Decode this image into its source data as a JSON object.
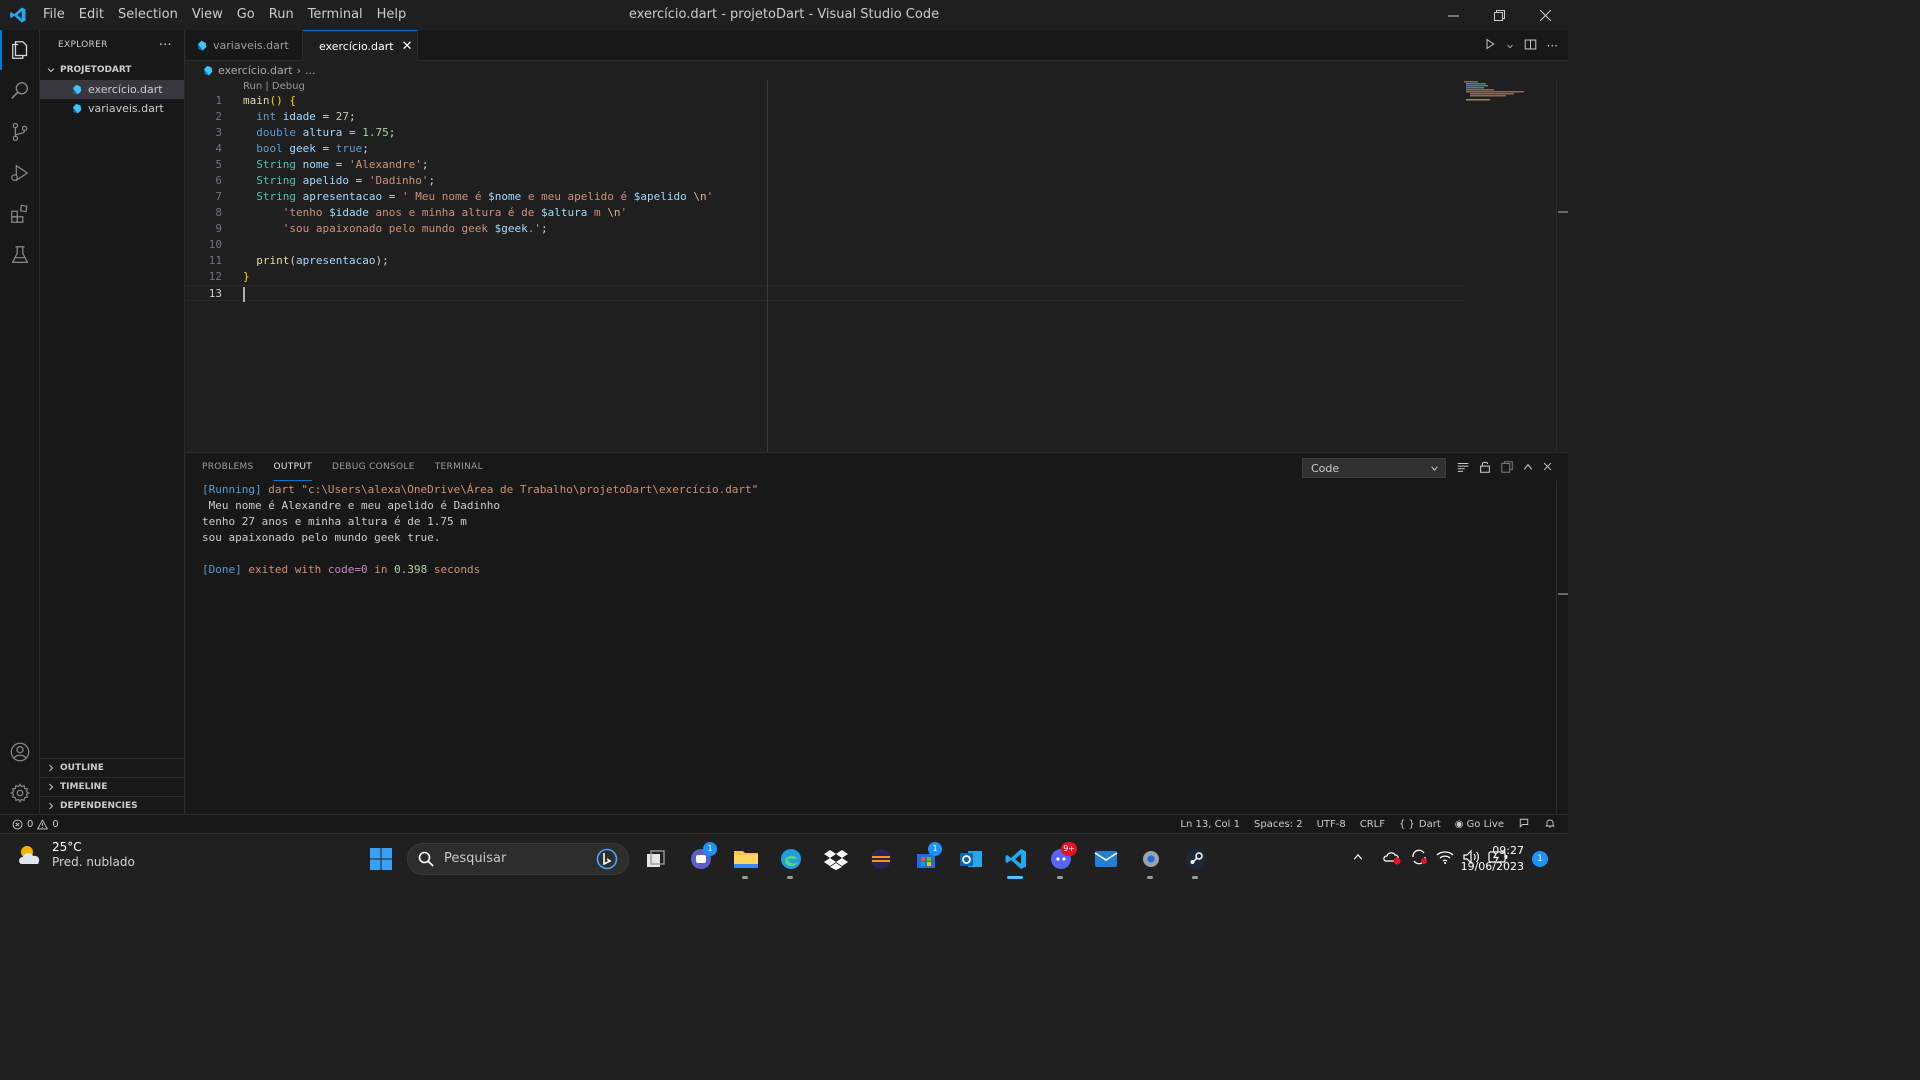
{
  "titlebar": {
    "menu": [
      "File",
      "Edit",
      "Selection",
      "View",
      "Go",
      "Run",
      "Terminal",
      "Help"
    ],
    "window_title": "exercício.dart - projetoDart - Visual Studio Code"
  },
  "sidebar": {
    "title": "EXPLORER",
    "project": "PROJETODART",
    "files": [
      "exercício.dart",
      "variaveis.dart"
    ],
    "sections": [
      "OUTLINE",
      "TIMELINE",
      "DEPENDENCIES"
    ]
  },
  "tabs": [
    {
      "label": "variaveis.dart"
    },
    {
      "label": "exercício.dart"
    }
  ],
  "breadcrumb": {
    "file": "exercício.dart",
    "rest": "..."
  },
  "editor": {
    "codelens": "Run | Debug",
    "line_numbers": [
      "1",
      "2",
      "3",
      "4",
      "5",
      "6",
      "7",
      "8",
      "9",
      "10",
      "11",
      "12",
      "13"
    ]
  },
  "panel": {
    "tabs": [
      "PROBLEMS",
      "OUTPUT",
      "DEBUG CONSOLE",
      "TERMINAL"
    ],
    "select_value": "Code",
    "output": {
      "running_tag": "[Running]",
      "running_cmd": " dart \"c:\\Users\\alexa\\OneDrive\\Área de Trabalho\\projetoDart\\exercício.dart\"",
      "line1": " Meu nome é Alexandre e meu apelido é Dadinho",
      "line2": "tenho 27 anos e minha altura é de 1.75 m",
      "line3": "sou apaixonado pelo mundo geek true.",
      "done_tag": "[Done]",
      "done_a": " exited with ",
      "done_code": "code=0",
      "done_b": " in ",
      "done_time": "0.398",
      "done_c": " seconds"
    }
  },
  "statusbar": {
    "errors": "0",
    "warnings": "0",
    "position": "Ln 13, Col 1",
    "spaces": "Spaces: 2",
    "encoding": "UTF-8",
    "eol": "CRLF",
    "language": "Dart",
    "golive": "Go Live"
  },
  "taskbar": {
    "temperature": "25°C",
    "weather": "Pred. nublado",
    "search_placeholder": "Pesquisar",
    "time": "09:27",
    "date": "19/06/2023",
    "teams_badge": "1",
    "store_badge": "1",
    "discord_badge": "9+",
    "notification_count": "1"
  },
  "colors": {
    "accent": "#0078d4",
    "dart_blue": "#40c4ff"
  }
}
